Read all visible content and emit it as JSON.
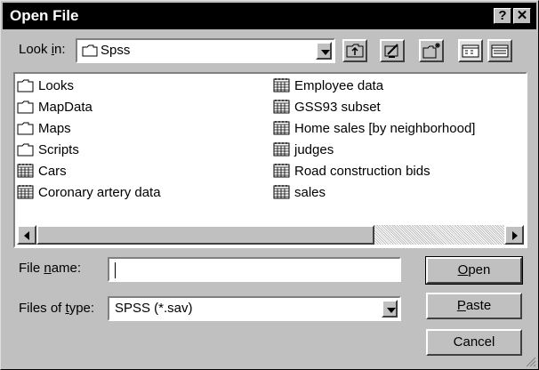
{
  "dialog": {
    "title": "Open File",
    "help_glyph": "?",
    "close_glyph": "✕"
  },
  "look_in": {
    "label_pre": "Look ",
    "label_u": "i",
    "label_post": "n:",
    "value": "Spss"
  },
  "files": [
    {
      "name": "Looks",
      "type": "folder"
    },
    {
      "name": "MapData",
      "type": "folder"
    },
    {
      "name": "Maps",
      "type": "folder"
    },
    {
      "name": "Scripts",
      "type": "folder"
    },
    {
      "name": "Cars",
      "type": "data"
    },
    {
      "name": "Coronary artery data",
      "type": "data"
    },
    {
      "name": "Employee data",
      "type": "data"
    },
    {
      "name": "GSS93 subset",
      "type": "data"
    },
    {
      "name": "Home sales [by neighborhood]",
      "type": "data"
    },
    {
      "name": "judges",
      "type": "data"
    },
    {
      "name": "Road construction bids",
      "type": "data"
    },
    {
      "name": "sales",
      "type": "data"
    }
  ],
  "file_name": {
    "label_pre": "File ",
    "label_u": "n",
    "label_post": "ame:",
    "value": ""
  },
  "file_type": {
    "label_pre": "Files of ",
    "label_u": "t",
    "label_post": "ype:",
    "value": "SPSS (*.sav)"
  },
  "buttons": {
    "open": {
      "u": "O",
      "rest": "pen"
    },
    "paste": {
      "u": "P",
      "rest": "aste"
    },
    "cancel": "Cancel"
  }
}
